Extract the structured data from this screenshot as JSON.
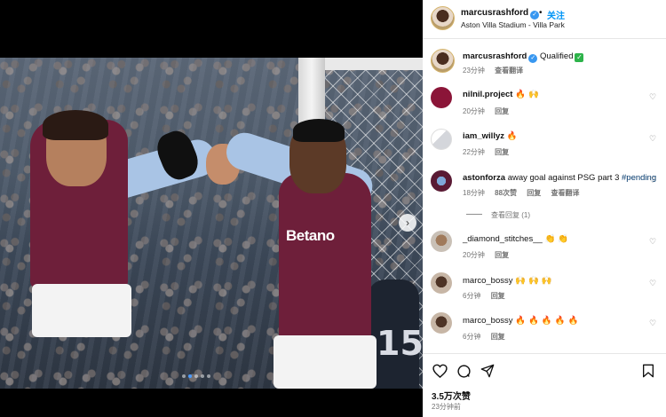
{
  "post": {
    "username": "marcusrashford",
    "follow_label": "关注",
    "separator": "•",
    "location": "Aston Villa Stadium - Villa Park",
    "caption_text": "Qualified",
    "caption_time": "23分钟",
    "caption_translate": "查看翻译",
    "sponsor_text": "Betano",
    "background_number": "15"
  },
  "comments": [
    {
      "username": "nilnil.project",
      "text": "🔥 🙌",
      "time": "20分钟",
      "reply": "回复"
    },
    {
      "username": "iam_willyz",
      "text": "🔥",
      "time": "22分钟",
      "reply": "回复"
    },
    {
      "username": "astonforza",
      "text": "away goal against PSG part 3",
      "hashtag": "#pending",
      "time": "18分钟",
      "likes": "88次赞",
      "reply": "回复",
      "translate": "查看翻译",
      "view_replies": "查看回复 (1)"
    },
    {
      "username": "_diamond_stitches__",
      "text": "👏 👏",
      "time": "20分钟",
      "reply": "回复"
    },
    {
      "username": "marco_bossy",
      "text": "🙌 🙌 🙌",
      "time": "6分钟",
      "reply": "回复"
    },
    {
      "username": "marco_bossy",
      "text": "🔥 🔥 🔥 🔥 🔥",
      "time": "6分钟",
      "reply": "回复"
    }
  ],
  "footer": {
    "likes": "3.5万次赞",
    "time_ago": "23分钟前"
  },
  "icons": {
    "like": "heart-icon",
    "comment": "comment-icon",
    "share": "share-icon",
    "save": "bookmark-icon",
    "next": "chevron-right-icon"
  },
  "colors": {
    "link_blue": "#0095f6",
    "verified": "#3897f0",
    "hashtag": "#00376b",
    "meta_gray": "#737373",
    "check_green": "#2db34a"
  }
}
